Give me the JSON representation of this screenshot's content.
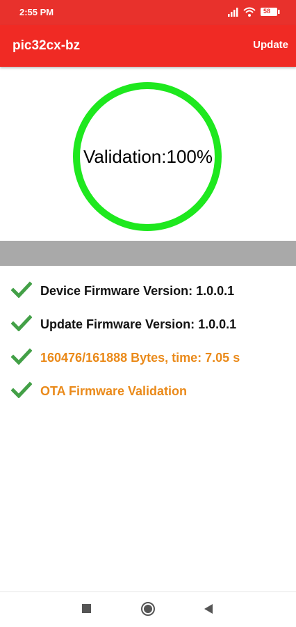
{
  "status_bar": {
    "time": "2:55 PM",
    "battery": "58"
  },
  "app_bar": {
    "title": "pic32cx-bz",
    "action_label": "Update"
  },
  "validation": {
    "text": "Validation:100%",
    "progress": 1.0
  },
  "steps": [
    {
      "label": "Device Firmware Version: 1.0.0.1",
      "state": "done"
    },
    {
      "label": "Update Firmware Version: 1.0.0.1",
      "state": "done"
    },
    {
      "label": "160476/161888 Bytes, time: 7.05 s",
      "state": "active"
    },
    {
      "label": "OTA  Firmware Validation",
      "state": "active"
    }
  ],
  "nav": {
    "items": [
      "recents-icon",
      "home-icon",
      "back-icon"
    ]
  },
  "colors": {
    "app_bar": "#f02a24",
    "ring": "#1ee81e",
    "check": "#43a047",
    "active_text": "#ea8a1a",
    "progress_track": "#a9a9a9"
  }
}
